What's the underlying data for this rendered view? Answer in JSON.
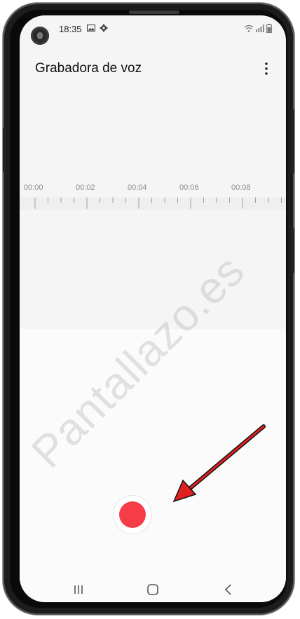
{
  "status_bar": {
    "time": "18:35"
  },
  "app_bar": {
    "title": "Grabadora de voz"
  },
  "timeline": {
    "labels": [
      "00:00",
      "00:02",
      "00:04",
      "00:06",
      "00:08"
    ]
  },
  "watermark": "Pantallazo.es",
  "colors": {
    "record": "#f63d47",
    "arrow": "#e02020"
  },
  "icons": {
    "gallery": "gallery-icon",
    "settings": "gear-icon",
    "wifi": "wifi-icon",
    "signal": "signal-icon",
    "battery": "battery-icon",
    "more": "more-vert-icon",
    "record": "record-icon",
    "recents": "recents-icon",
    "home": "home-icon",
    "back": "back-icon"
  }
}
